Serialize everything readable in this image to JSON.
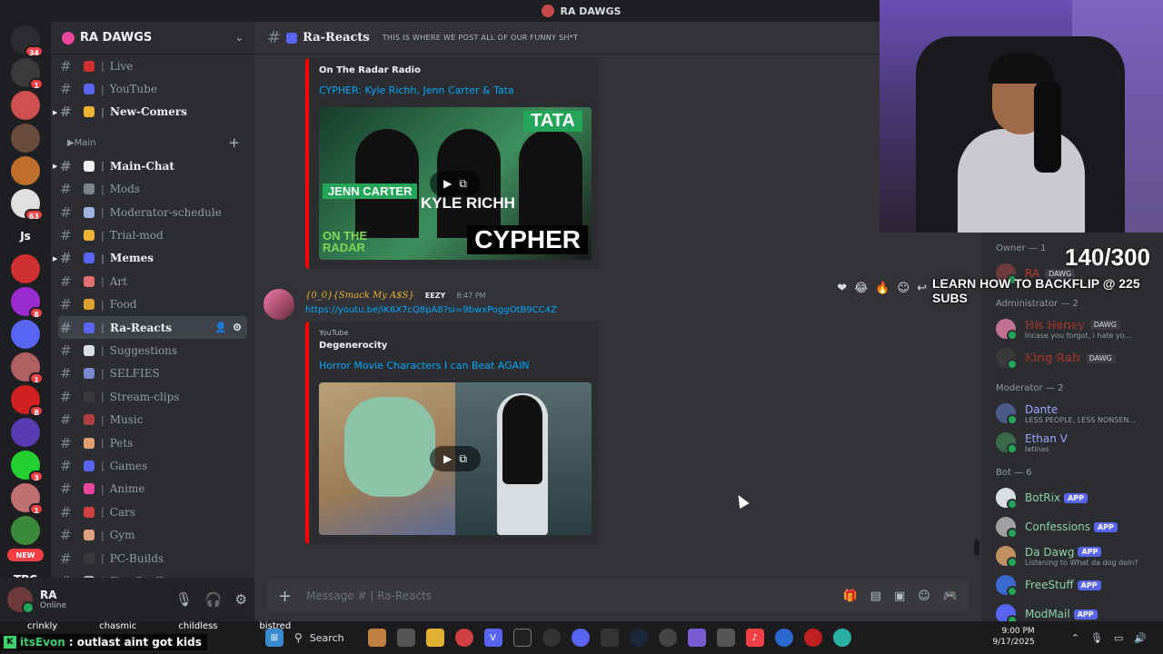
{
  "window": {
    "title": "RA DAWGS"
  },
  "rail": {
    "servers": [
      {
        "color": "#2b2d31",
        "badge": "34",
        "label": ""
      },
      {
        "color": "#3b3b3b",
        "badge": "1",
        "label": ""
      },
      {
        "color": "#d05050",
        "badge": "",
        "label": ""
      },
      {
        "color": "#6a4a3a",
        "badge": "",
        "label": ""
      },
      {
        "color": "#c0702a",
        "badge": "",
        "label": ""
      },
      {
        "color": "#e0e0e0",
        "badge": "63",
        "label": ""
      },
      {
        "color": "transparent",
        "badge": "",
        "label": "Js"
      },
      {
        "color": "#d03030",
        "badge": "",
        "label": ""
      },
      {
        "color": "#9b2ad0",
        "badge": "8",
        "label": ""
      },
      {
        "color": "#5865f2",
        "badge": "",
        "label": ""
      },
      {
        "color": "#b06060",
        "badge": "1",
        "label": ""
      },
      {
        "color": "#d02020",
        "badge": "8",
        "label": ""
      },
      {
        "color": "#5a3ab0",
        "badge": "",
        "label": ""
      },
      {
        "color": "#23d030",
        "badge": "3",
        "label": ""
      },
      {
        "color": "#c07070",
        "badge": "1",
        "label": ""
      },
      {
        "color": "#3a8a3a",
        "badge": "",
        "label": ""
      }
    ],
    "new_label": "NEW",
    "bottom_label": "TPC"
  },
  "sidebar": {
    "server_name": "RA DAWGS",
    "channels_top": [
      {
        "name": "Live",
        "emoji": "#d03030",
        "bold": false,
        "arrow": false
      },
      {
        "name": "YouTube",
        "emoji": "#5865f2",
        "bold": false,
        "arrow": false
      },
      {
        "name": "New-Comers",
        "emoji": "#f0b232",
        "bold": true,
        "arrow": true
      }
    ],
    "category": "Main",
    "channels": [
      {
        "name": "Main-Chat",
        "emoji": "#f2f3f5",
        "bold": true,
        "arrow": true,
        "active": false
      },
      {
        "name": "Mods",
        "emoji": "#80848e",
        "bold": false,
        "arrow": false,
        "active": false
      },
      {
        "name": "Moderator-schedule",
        "emoji": "#a0b4e0",
        "bold": false,
        "arrow": false,
        "active": false
      },
      {
        "name": "Trial-mod",
        "emoji": "#f0b232",
        "bold": false,
        "arrow": false,
        "active": false
      },
      {
        "name": "Memes",
        "emoji": "#5865f2",
        "bold": true,
        "arrow": true,
        "active": false
      },
      {
        "name": "Art",
        "emoji": "#e07070",
        "bold": false,
        "arrow": false,
        "active": false
      },
      {
        "name": "Food",
        "emoji": "#e0a030",
        "bold": false,
        "arrow": false,
        "active": false
      },
      {
        "name": "Ra-Reacts",
        "emoji": "#5865f2",
        "bold": true,
        "arrow": false,
        "active": true
      },
      {
        "name": "Suggestions",
        "emoji": "#dbdee1",
        "bold": false,
        "arrow": false,
        "active": false
      },
      {
        "name": "SELFIES",
        "emoji": "#7a8ad0",
        "bold": false,
        "arrow": false,
        "active": false
      },
      {
        "name": "Stream-clips",
        "emoji": "#3a3a3a",
        "bold": false,
        "arrow": false,
        "active": false
      },
      {
        "name": "Music",
        "emoji": "#b04040",
        "bold": false,
        "arrow": false,
        "active": false
      },
      {
        "name": "Pets",
        "emoji": "#e0a070",
        "bold": false,
        "arrow": false,
        "active": false
      },
      {
        "name": "Games",
        "emoji": "#5865f2",
        "bold": false,
        "arrow": false,
        "active": false
      },
      {
        "name": "Anime",
        "emoji": "#eb459e",
        "bold": false,
        "arrow": false,
        "active": false
      },
      {
        "name": "Cars",
        "emoji": "#d04040",
        "bold": false,
        "arrow": false,
        "active": false
      },
      {
        "name": "Gym",
        "emoji": "#e0a080",
        "bold": false,
        "arrow": false,
        "active": false
      },
      {
        "name": "PC-Builds",
        "emoji": "#3a3a3a",
        "bold": false,
        "arrow": false,
        "active": false
      },
      {
        "name": "FreeStuff",
        "emoji": "#b0b0b0",
        "bold": false,
        "arrow": false,
        "active": false
      }
    ]
  },
  "user": {
    "name": "RA",
    "status": "Online"
  },
  "channel": {
    "name": "Ra-Reacts",
    "topic": "THIS IS WHERE WE POST ALL OF OUR FUNNY SH*T"
  },
  "messages": {
    "embed1": {
      "author": "On The Radar Radio",
      "title": "CYPHER: Kyle Richh, Jenn Carter & Tata",
      "thumb_text": {
        "tata": "TATA",
        "jenn": "JENN CARTER",
        "kyle": "KYLE RICHH",
        "cypher": "CYPHER",
        "otr": "ON THE\nRADAR"
      }
    },
    "msg2": {
      "user": "{0_0}{Smack My A$S}",
      "tag": "EEZY",
      "time": "8:47 PM",
      "link": "https://youtu.be/iK6X7cQ8pA8?si=9bwxPoggOtB9CC4Z",
      "embed": {
        "provider": "YouTube",
        "author": "Degenerocity",
        "title": "Horror Movie Characters I can Beat AGAIN"
      }
    },
    "reactions": [
      "❤",
      "😂",
      "🔥",
      "☺",
      "↩"
    ]
  },
  "composer": {
    "placeholder": "Message #  |  Ra-Reacts"
  },
  "members": {
    "groups": [
      {
        "title": "Owner — 1",
        "items": [
          {
            "name": "RA",
            "status": "",
            "color": "#c0392b",
            "tag": "DAWG",
            "app": false,
            "av": "#6d3b3b"
          }
        ]
      },
      {
        "title": "Administrator — 2",
        "items": [
          {
            "name": "ℍ𝕚𝕤 ℍ𝕠𝕟𝕖𝕪",
            "status": "Incase you forgot, i hate yo...",
            "color": "#c0392b",
            "tag": "DAWG",
            "app": false,
            "av": "#c07090"
          },
          {
            "name": "𝕂𝕚𝕟𝕘 ℝ𝕒𝕙",
            "status": "",
            "color": "#c0392b",
            "tag": "DAWG",
            "app": false,
            "av": "#3a3a3a"
          }
        ]
      },
      {
        "title": "Moderator — 2",
        "items": [
          {
            "name": "Dante",
            "status": "LESS PEOPLE, LESS NONSEN...",
            "color": "#9aa7ff",
            "tag": "",
            "app": false,
            "av": "#4a5a8a"
          },
          {
            "name": "Ethan V",
            "status": "latinas",
            "color": "#9aa7ff",
            "tag": "",
            "app": false,
            "av": "#3a6a4a"
          }
        ]
      },
      {
        "title": "Bot — 6",
        "items": [
          {
            "name": "BotRix",
            "status": "",
            "color": "#8fd5a6",
            "tag": "",
            "app": true,
            "av": "#dbdee1"
          },
          {
            "name": "Confessions",
            "status": "",
            "color": "#8fd5a6",
            "tag": "",
            "app": true,
            "av": "#a0a0a0"
          },
          {
            "name": "Da Dawg",
            "status": "Listening to What da dog doin?",
            "color": "#8fd5a6",
            "tag": "",
            "app": true,
            "av": "#c09060"
          },
          {
            "name": "FreeStuff",
            "status": "",
            "color": "#8fd5a6",
            "tag": "",
            "app": true,
            "av": "#3a6ad0"
          },
          {
            "name": "ModMail",
            "status": "",
            "color": "#8fd5a6",
            "tag": "",
            "app": true,
            "av": "#5865f2"
          }
        ]
      }
    ],
    "app_label": "APP"
  },
  "stream": {
    "sub_count": "140/300",
    "sub_goal": "LEARN HOW TO BACKFLIP @ 225 SUBS",
    "chat_names": [
      "crinkly",
      "chasmic",
      "childless",
      "bistred"
    ],
    "chat_user": "itsEvon",
    "chat_msg": "outlast aint got kids"
  },
  "taskbar": {
    "search": "Search",
    "time": "9:00 PM",
    "date": "9/17/2025"
  }
}
